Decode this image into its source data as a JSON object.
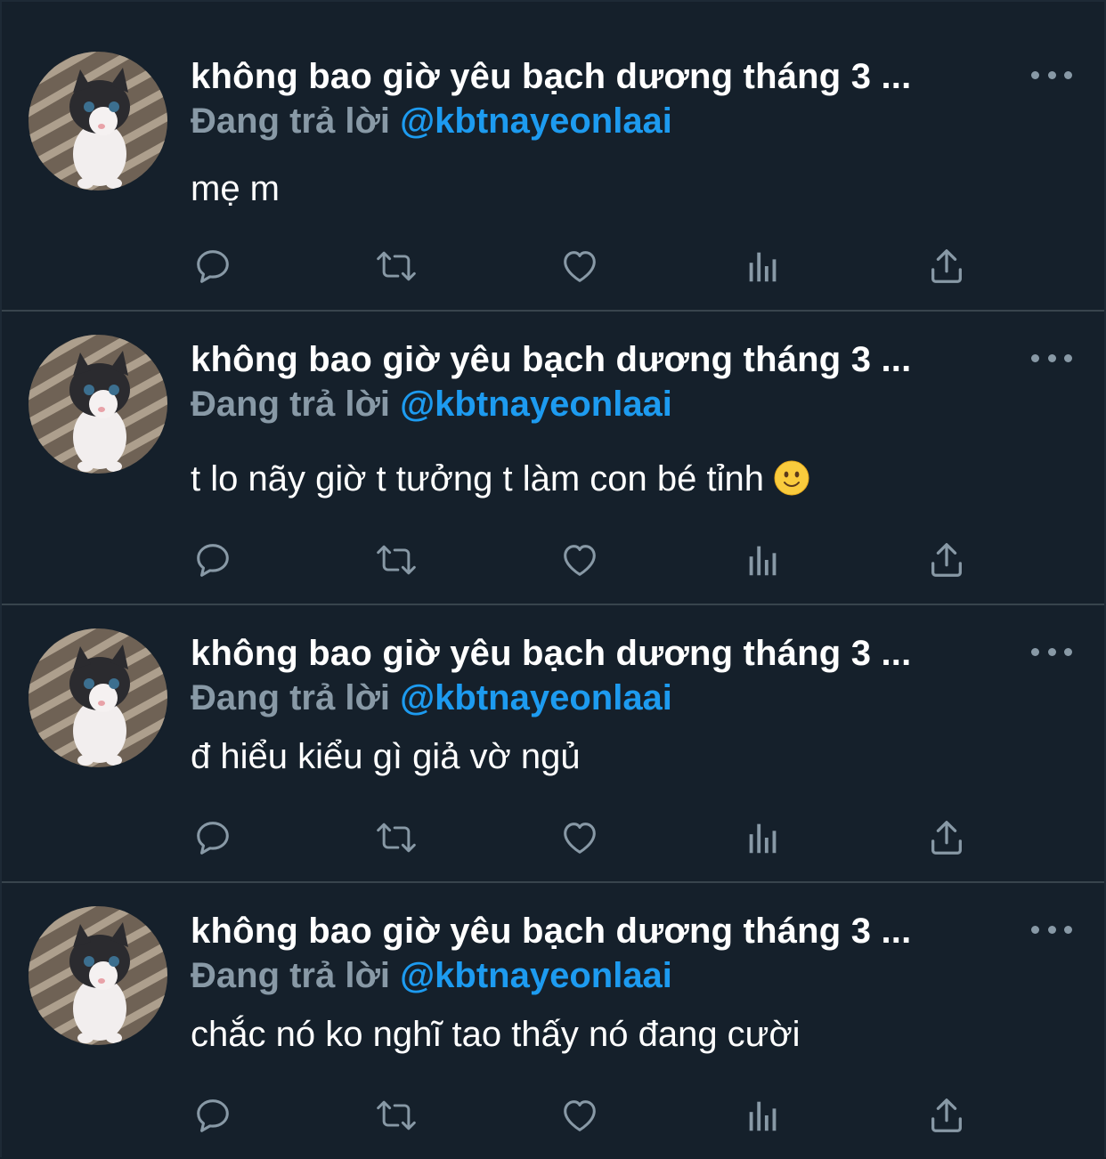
{
  "tweets": [
    {
      "display_name": "không bao giờ yêu bạch dương tháng 3 ...",
      "reply_prefix": "Đang trả lời",
      "reply_handle": "@kbtnayeonlaai",
      "text": "mẹ m",
      "emoji": ""
    },
    {
      "display_name": "không bao giờ yêu bạch dương tháng 3 ...",
      "reply_prefix": "Đang trả lời",
      "reply_handle": "@kbtnayeonlaai",
      "text": "t lo nãy giờ t tưởng t làm con bé tỉnh",
      "emoji": "slightly-smiling-face"
    },
    {
      "display_name": "không bao giờ yêu bạch dương tháng 3 ...",
      "reply_prefix": "Đang trả lời",
      "reply_handle": "@kbtnayeonlaai",
      "text": "đ hiểu kiểu gì giả vờ ngủ",
      "emoji": ""
    },
    {
      "display_name": "không bao giờ yêu bạch dương tháng 3 ...",
      "reply_prefix": "Đang trả lời",
      "reply_handle": "@kbtnayeonlaai",
      "text": "chắc nó ko nghĩ tao thấy nó đang cười",
      "emoji": ""
    }
  ],
  "action_icons": [
    "reply-icon",
    "retweet-icon",
    "like-icon",
    "analytics-icon",
    "share-icon"
  ],
  "colors": {
    "background": "#15202b",
    "divider": "#38444d",
    "text_primary": "#ffffff",
    "text_secondary": "#8899a6",
    "link": "#1d9bf0"
  }
}
